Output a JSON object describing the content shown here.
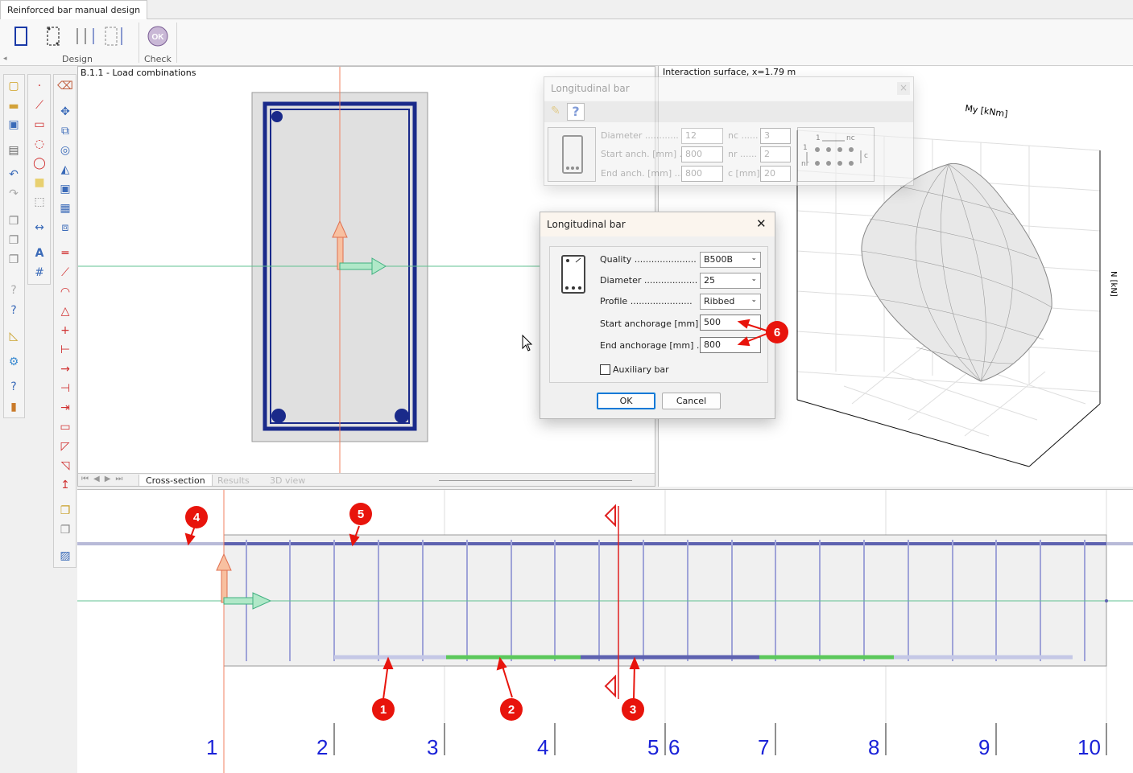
{
  "ribbon": {
    "tab_active": "Reinforced bar manual design",
    "groups": {
      "design": "Design",
      "check": "Check"
    },
    "check_icon_text": "OK"
  },
  "cross_section_pane": {
    "title": "B.1.1 - Load combinations",
    "tabs": [
      "Cross-section",
      "Results",
      "3D view"
    ]
  },
  "interaction_pane": {
    "title": "Interaction surface, x=1.79 m",
    "axis_my": "My [kNm]",
    "axis_n": "N [kN]"
  },
  "dialog_bg": {
    "title": "Longitudinal bar",
    "close": "×",
    "help_icon": "?",
    "fields": {
      "diameter_label": "Diameter ............",
      "diameter_value": "12",
      "start_label": "Start anch. [mm] ..",
      "start_value": "800",
      "end_label": "End anch. [mm] ....",
      "end_value": "800",
      "nc_label": "nc ......",
      "nc_value": "3",
      "nr_label": "nr ......",
      "nr_value": "2",
      "c_label": "c [mm]",
      "c_value": "20"
    },
    "scheme": {
      "one": "1",
      "nc": "nc",
      "nr": "nr",
      "c": "c"
    }
  },
  "dialog": {
    "title": "Longitudinal bar",
    "close": "✕",
    "quality_label": "Quality ......................",
    "quality_value": "B500B",
    "diameter_label": "Diameter ...................",
    "diameter_value": "25",
    "profile_label": "Profile ......................",
    "profile_value": "Ribbed",
    "start_anchorage_label": "Start anchorage [mm] ..",
    "start_anchorage_value": "500",
    "end_anchorage_label": "End anchorage [mm] ....",
    "end_anchorage_value": "800",
    "auxiliary_label": "Auxiliary bar",
    "ok": "OK",
    "cancel": "Cancel"
  },
  "markers": [
    "1",
    "2",
    "3",
    "4",
    "5",
    "6"
  ],
  "section_numbers": [
    "1",
    "2",
    "3",
    "4",
    "5",
    "6",
    "7",
    "8",
    "9",
    "10"
  ],
  "colors": {
    "rebar": "#1a2a8a",
    "stirrup_long": "#9fa3d8",
    "longbar": "#5e62b0",
    "green_bar": "#5cc85c",
    "light_bar": "#c5c8e6",
    "marker": "#e8140c",
    "section_number": "#1a22d8"
  }
}
